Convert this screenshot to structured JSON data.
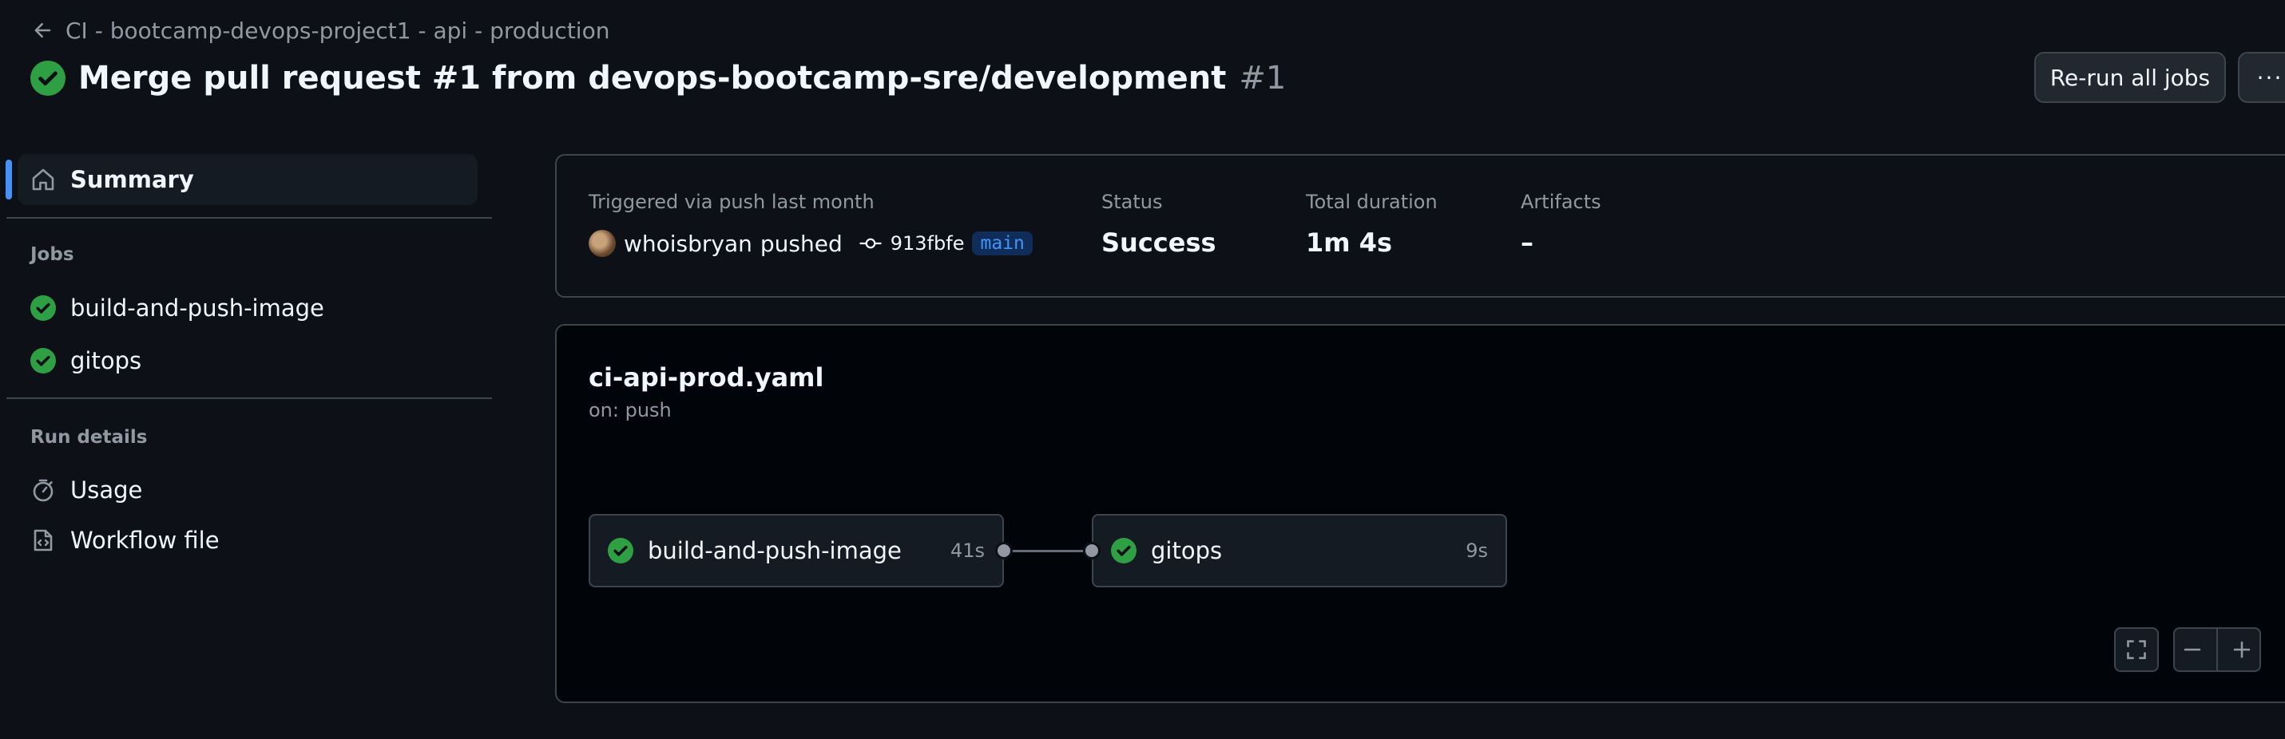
{
  "header": {
    "breadcrumb": "CI - bootcamp-devops-project1 - api - production",
    "title": "Merge pull request #1 from devops-bootcamp-sre/development",
    "run_number": "#1",
    "rerun_label": "Re-run all jobs",
    "more_label": "···"
  },
  "sidebar": {
    "summary_label": "Summary",
    "jobs_heading": "Jobs",
    "jobs": [
      {
        "label": "build-and-push-image",
        "status": "success"
      },
      {
        "label": "gitops",
        "status": "success"
      }
    ],
    "run_details_heading": "Run details",
    "usage_label": "Usage",
    "workflow_file_label": "Workflow file"
  },
  "summary": {
    "trigger_label": "Triggered via push last month",
    "actor": "whoisbryan",
    "action": "pushed",
    "commit": "913fbfe",
    "branch": "main",
    "status_label": "Status",
    "status_value": "Success",
    "duration_label": "Total duration",
    "duration_value": "1m 4s",
    "artifacts_label": "Artifacts",
    "artifacts_value": "–"
  },
  "workflow": {
    "file": "ci-api-prod.yaml",
    "trigger": "on: push",
    "jobs": [
      {
        "name": "build-and-push-image",
        "duration": "41s"
      },
      {
        "name": "gitops",
        "duration": "9s"
      }
    ]
  },
  "colors": {
    "background": "#0d1117",
    "success": "#2ea043",
    "accent": "#4493f8",
    "border": "#3d444d"
  }
}
